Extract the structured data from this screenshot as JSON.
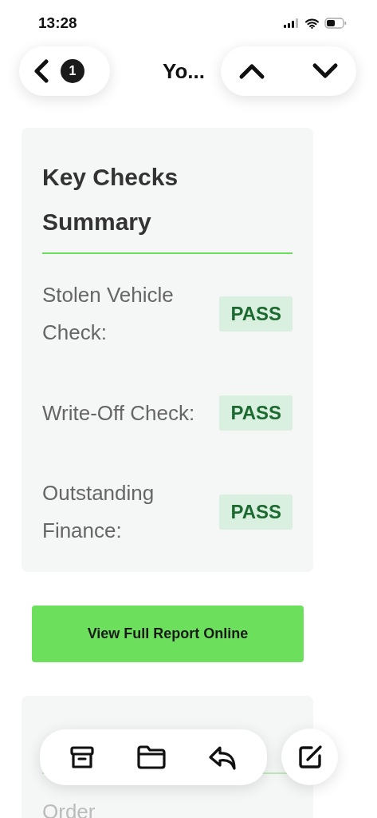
{
  "status_bar": {
    "time": "13:28"
  },
  "nav": {
    "badge": "1",
    "title": "Yo..."
  },
  "summary": {
    "title": "Key Checks Summary",
    "checks": [
      {
        "label": "Stolen Vehicle Check:",
        "result": "PASS",
        "kind": "pass"
      },
      {
        "label": "Write-Off Check:",
        "result": "PASS",
        "kind": "pass"
      },
      {
        "label": "Outstanding Finance:",
        "result": "PASS",
        "kind": "pass"
      }
    ]
  },
  "report_button": "View Full Report Online",
  "next_card": {
    "label": "Order"
  }
}
